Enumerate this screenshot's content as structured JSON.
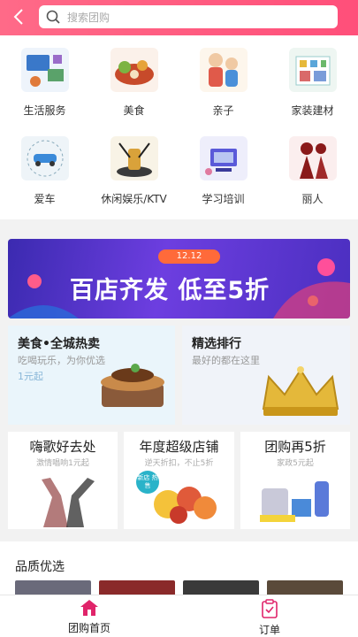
{
  "search": {
    "placeholder": "搜索团购"
  },
  "categories": [
    {
      "label": "生活服务",
      "icon": "life-service-icon"
    },
    {
      "label": "美食",
      "icon": "food-icon"
    },
    {
      "label": "亲子",
      "icon": "parent-child-icon"
    },
    {
      "label": "家装建材",
      "icon": "home-decor-icon"
    },
    {
      "label": "爱车",
      "icon": "car-icon"
    },
    {
      "label": "休闲娱乐/KTV",
      "icon": "leisure-ktv-icon"
    },
    {
      "label": "学习培训",
      "icon": "training-icon"
    },
    {
      "label": "丽人",
      "icon": "beauty-icon"
    }
  ],
  "banner": {
    "date": "12.12",
    "text": "百店齐发  低至5折"
  },
  "promos": [
    {
      "title": "美食•全城热卖",
      "subtitle": "吃喝玩乐，为你优选",
      "tag": "1元起"
    },
    {
      "title": "精选排行",
      "subtitle": "最好的都在这里"
    }
  ],
  "small_promos": [
    {
      "title": "嗨歌好去处",
      "subtitle": "激情唱响1元起"
    },
    {
      "title": "年度超级店铺",
      "subtitle": "逆天折扣，不止5折",
      "badge": "新店 热售"
    },
    {
      "title": "团购再5折",
      "subtitle": "家政5元起"
    }
  ],
  "quality": {
    "title": "品质优选"
  },
  "tabs": [
    {
      "label": "团购首页",
      "active": true,
      "icon": "home-icon"
    },
    {
      "label": "订单",
      "active": false,
      "icon": "order-icon"
    }
  ],
  "colors": {
    "accent": "#e0246a",
    "header": "#ff5a80"
  }
}
